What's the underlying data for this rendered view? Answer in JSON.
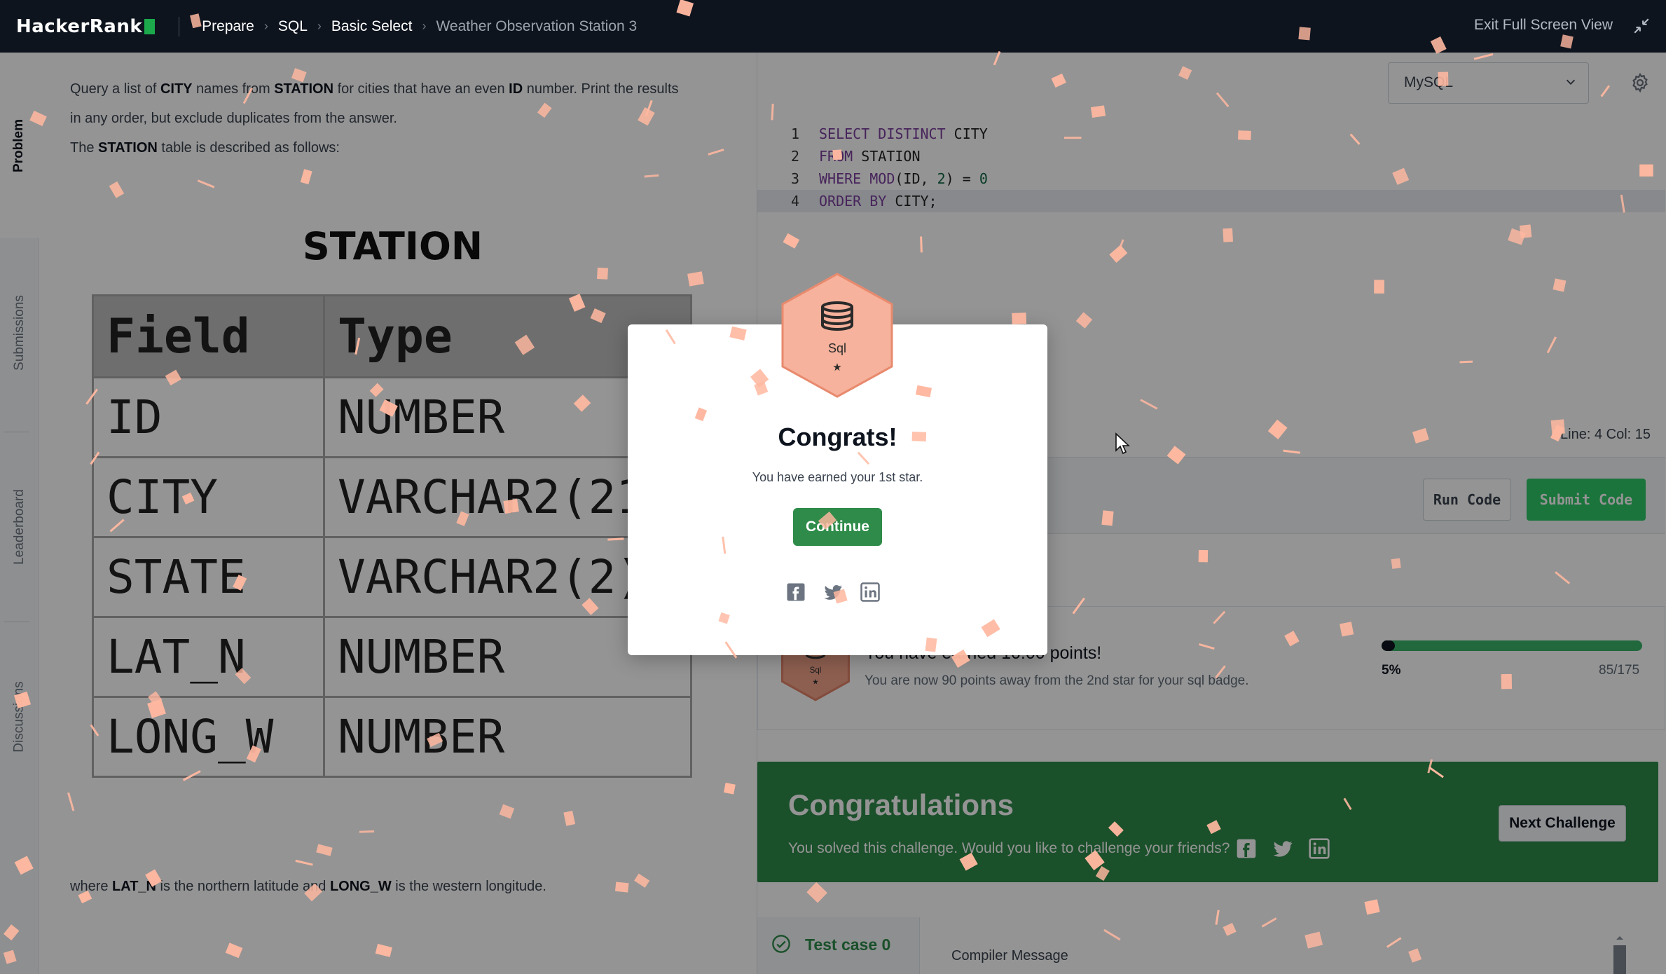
{
  "topbar": {
    "logo": "HackerRank",
    "breadcrumb": [
      "Prepare",
      "SQL",
      "Basic Select",
      "Weather Observation Station 3"
    ],
    "exit_fullscreen": "Exit Full Screen View"
  },
  "rail": {
    "tabs": [
      "Problem",
      "Submissions",
      "Leaderboard",
      "Discussions"
    ],
    "active": "Problem"
  },
  "problem": {
    "line1_parts": [
      "Query a list of ",
      "CITY",
      " names from ",
      "STATION",
      " for cities that have an even ",
      "ID",
      " number. Print the results"
    ],
    "line2": "in any order, but exclude duplicates from the answer.",
    "line3_parts": [
      "The ",
      "STATION",
      " table is described as follows:"
    ],
    "table_title": "STATION",
    "table_headers": [
      "Field",
      "Type"
    ],
    "table_rows": [
      [
        "ID",
        "NUMBER"
      ],
      [
        "CITY",
        "VARCHAR2(21)"
      ],
      [
        "STATE",
        "VARCHAR2(2)"
      ],
      [
        "LAT_N",
        "NUMBER"
      ],
      [
        "LONG_W",
        "NUMBER"
      ]
    ],
    "where_parts": [
      "where ",
      "LAT_N",
      " is the northern latitude and ",
      "LONG_W",
      " is the western longitude."
    ]
  },
  "editor": {
    "language": "MySQL",
    "line_numbers": [
      "1",
      "2",
      "3",
      "4"
    ],
    "code": {
      "l1_kw": "SELECT DISTINCT",
      "l1_rest": " CITY",
      "l2_kw": "FROM",
      "l2_rest": " STATION",
      "l3_kw": "WHERE MOD",
      "l3_a": "(ID, ",
      "l3_n1": "2",
      "l3_b": ") = ",
      "l3_n2": "0",
      "l4_kw": "ORDER BY",
      "l4_rest": " CITY;"
    },
    "cursor_position": "Line: 4 Col: 15",
    "run_label": "Run Code",
    "submit_label": "Submit Code"
  },
  "earned": {
    "badge_label": "Sql",
    "title": "You have earned 10.00 points!",
    "subtitle": "You are now 90 points away from the 2nd star for your sql badge.",
    "progress_percent": 5,
    "progress_label": "5%",
    "progress_count": "85/175"
  },
  "banner": {
    "title": "Congratulations",
    "subtitle": "You solved this challenge. Would you like to challenge your friends?",
    "next_label": "Next Challenge"
  },
  "testcase": {
    "label": "Test case 0",
    "compiler_label": "Compiler Message"
  },
  "modal": {
    "badge_label": "Sql",
    "title": "Congrats!",
    "subtitle": "You have earned your 1st star.",
    "continue_label": "Continue",
    "social_icons": [
      "facebook-icon",
      "twitter-icon",
      "linkedin-icon"
    ]
  },
  "colors": {
    "topbar_bg": "#0e141e",
    "brand_green": "#2e8b49",
    "submit_green": "#2ec866",
    "badge_peach": "#f3a48b",
    "confetti": "#ffb8a0"
  }
}
